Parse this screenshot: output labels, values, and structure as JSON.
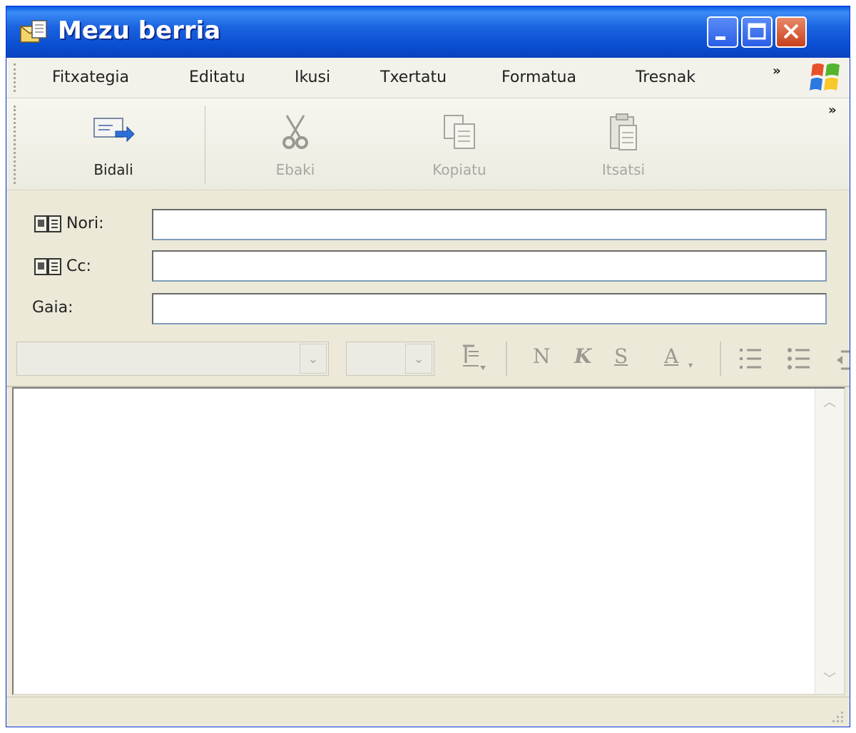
{
  "window": {
    "title": "Mezu berria"
  },
  "menu": [
    "Fitxategia",
    "Editatu",
    "Ikusi",
    "Txertatu",
    "Formatua",
    "Tresnak"
  ],
  "menu_overflow": "»",
  "toolbar": {
    "send": "Bidali",
    "cut": "Ebaki",
    "copy": "Kopiatu",
    "paste": "Itsatsi",
    "overflow": "»"
  },
  "fields": {
    "to_label": "Nori:",
    "to_value": "",
    "cc_label": "Cc:",
    "cc_value": "",
    "subject_label": "Gaia:",
    "subject_value": ""
  },
  "format": {
    "font_name": "",
    "font_size": "",
    "bold": "N",
    "italic": "K",
    "underline": "S",
    "font_color": "A"
  },
  "icons": {
    "app": "new-message-icon",
    "send": "send-envelope-icon",
    "cut": "scissors-icon",
    "copy": "copy-icon",
    "paste": "paste-icon",
    "address_book": "address-book-icon"
  },
  "colors": {
    "titlebar": "#0a4fd2",
    "close": "#c8401c",
    "chrome": "#ece9d8",
    "disabled_text": "#9a9890"
  }
}
